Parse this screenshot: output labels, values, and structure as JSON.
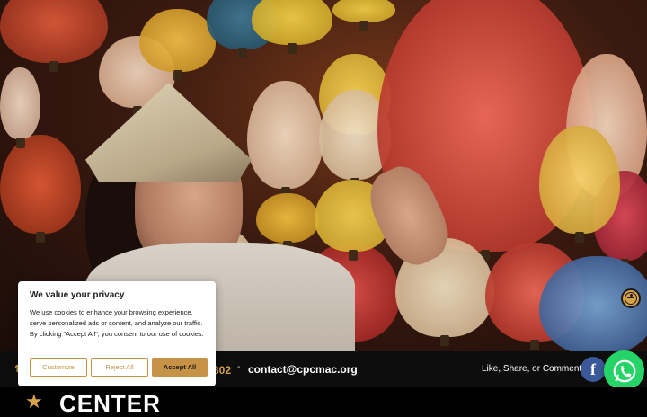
{
  "cookie_banner": {
    "title": "We value your privacy",
    "body": "We use cookies to enhance your browsing experience, serve personalized ads or content, and analyze our traffic. By clicking \"Accept All\", you consent to our use of cookies.",
    "customize_label": "Customize",
    "reject_label": "Reject All",
    "accept_label": "Accept All"
  },
  "topbar": {
    "phone_partial": "802",
    "email": "contact@cpcmac.org",
    "social_text": "Like, Share, or Comment"
  },
  "logo": {
    "text": "CENTER"
  },
  "colors": {
    "accent": "#d6a24a",
    "facebook": "#3b5998",
    "whatsapp": "#25d366",
    "topbar_bg": "#0d0d0d"
  },
  "icons": {
    "phone": "phone-icon",
    "facebook": "facebook-icon",
    "whatsapp": "whatsapp-icon",
    "accessibility": "accessibility-icon",
    "logo": "star-icon"
  }
}
